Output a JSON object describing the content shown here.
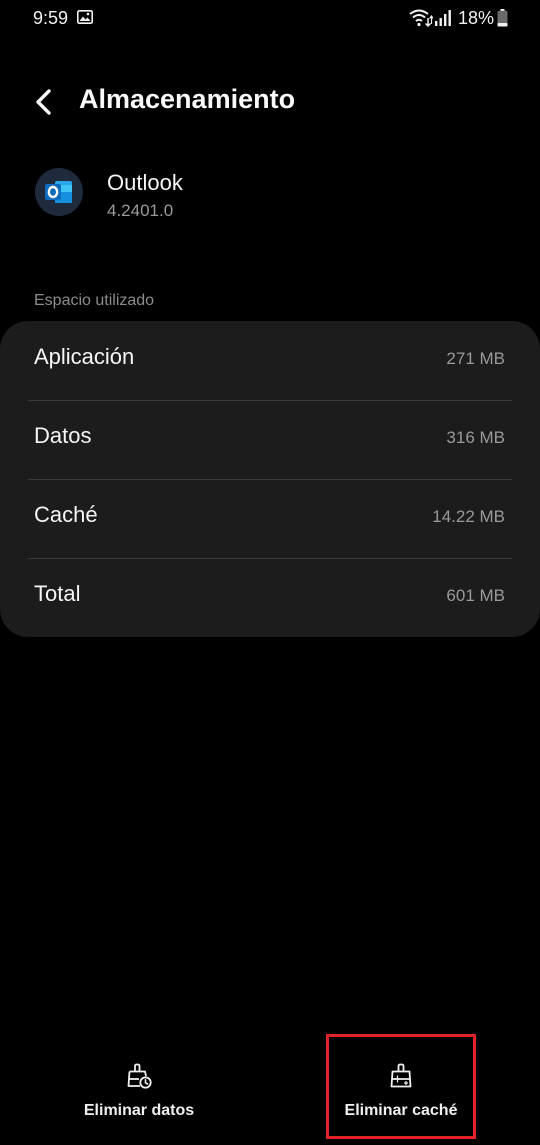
{
  "status_bar": {
    "time": "9:59",
    "battery_percent": "18%",
    "icons": [
      "gallery-icon",
      "wifi-icon",
      "signal-icon",
      "battery-icon"
    ]
  },
  "header": {
    "back_icon": "chevron-left-icon",
    "title": "Almacenamiento"
  },
  "app": {
    "name": "Outlook",
    "version": "4.2401.0",
    "icon": "outlook-app-icon"
  },
  "storage": {
    "section_label": "Espacio utilizado",
    "rows": [
      {
        "label": "Aplicación",
        "value": "271 MB"
      },
      {
        "label": "Datos",
        "value": "316 MB"
      },
      {
        "label": "Caché",
        "value": "14.22 MB"
      },
      {
        "label": "Total",
        "value": "601 MB"
      }
    ]
  },
  "actions": {
    "clear_data": {
      "label": "Eliminar datos",
      "icon": "clear-data-icon"
    },
    "clear_cache": {
      "label": "Eliminar caché",
      "icon": "clear-cache-icon",
      "highlighted": true
    }
  },
  "colors": {
    "background": "#000000",
    "card": "#1c1c1c",
    "highlight": "#e0242a",
    "outlook_blue": "#0f6cbd"
  }
}
